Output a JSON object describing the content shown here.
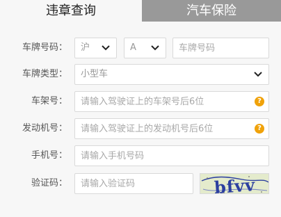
{
  "tabs": {
    "violation_query": "违章查询",
    "car_insurance": "汽车保险"
  },
  "form": {
    "plate": {
      "label": "车牌号码：",
      "province": "沪",
      "letter": "A",
      "placeholder": "车牌号码"
    },
    "plate_type": {
      "label": "车牌类型：",
      "value": "小型车"
    },
    "frame": {
      "label": "车架号：",
      "placeholder": "请输入驾驶证上的车架号后6位",
      "help": "?"
    },
    "engine": {
      "label": "发动机号：",
      "placeholder": "请输入驾驶证上的发动机号后6位",
      "help": "?"
    },
    "phone": {
      "label": "手机号：",
      "placeholder": "请输入手机号码"
    },
    "captcha": {
      "label": "验证码：",
      "placeholder": "请输入验证码",
      "image_text": "bfvv"
    }
  },
  "colors": {
    "active_tab_bg": "#f7f7f7",
    "inactive_tab_bg": "#999999",
    "help_icon": "#f0a20a",
    "captcha_text": "#2c3fa0"
  }
}
